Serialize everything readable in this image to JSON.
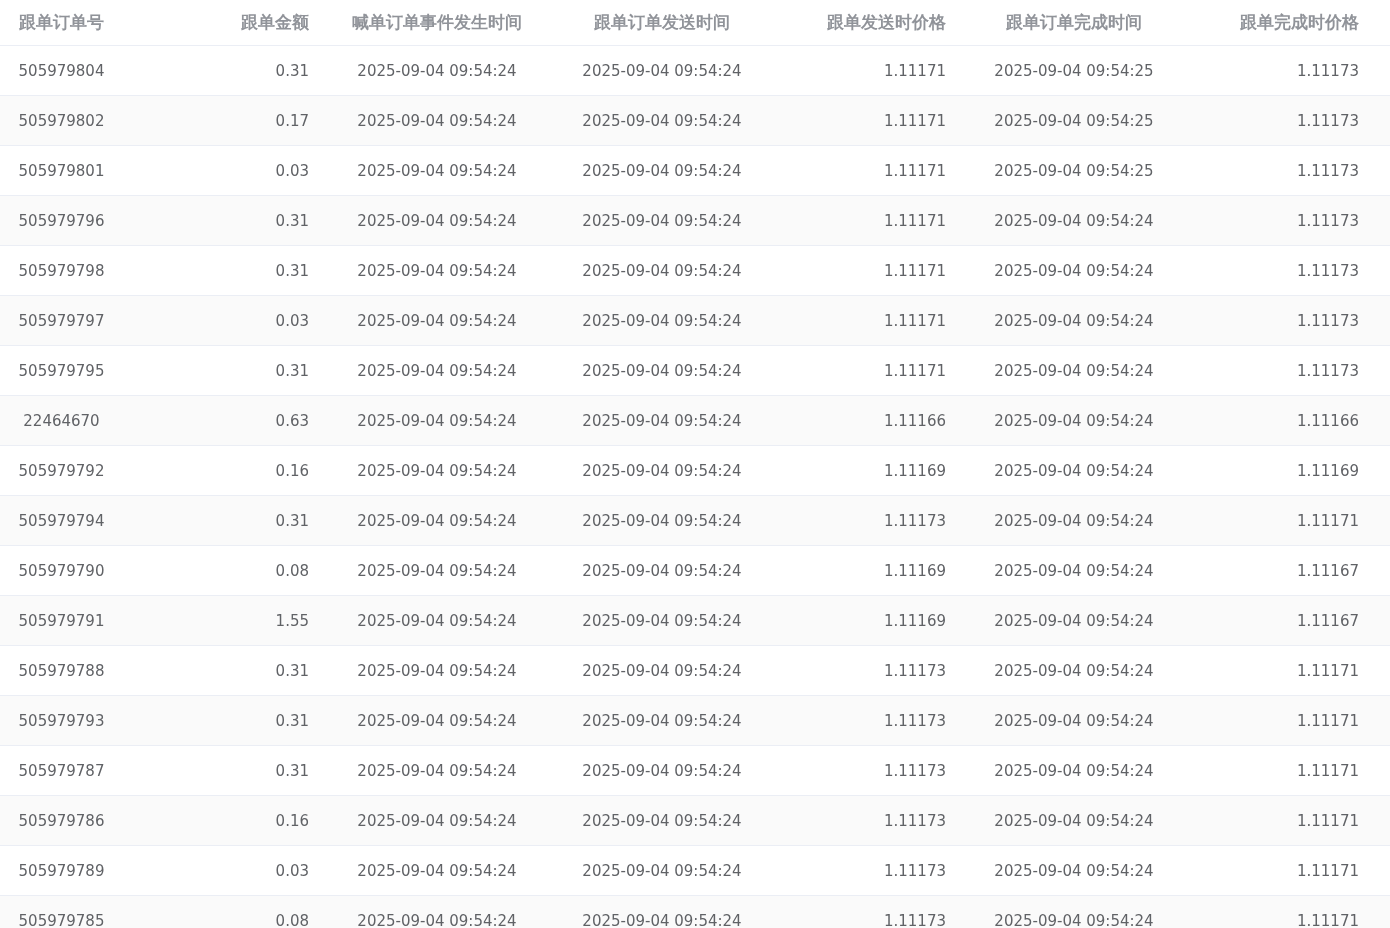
{
  "table": {
    "columns": [
      "跟单订单号",
      "跟单金额",
      "喊单订单事件发生时间",
      "跟单订单发送时间",
      "跟单发送时价格",
      "跟单订单完成时间",
      "跟单完成时价格"
    ],
    "rows": [
      [
        "505979804",
        "0.31",
        "2025-09-04 09:54:24",
        "2025-09-04 09:54:24",
        "1.11171",
        "2025-09-04 09:54:25",
        "1.11173"
      ],
      [
        "505979802",
        "0.17",
        "2025-09-04 09:54:24",
        "2025-09-04 09:54:24",
        "1.11171",
        "2025-09-04 09:54:25",
        "1.11173"
      ],
      [
        "505979801",
        "0.03",
        "2025-09-04 09:54:24",
        "2025-09-04 09:54:24",
        "1.11171",
        "2025-09-04 09:54:25",
        "1.11173"
      ],
      [
        "505979796",
        "0.31",
        "2025-09-04 09:54:24",
        "2025-09-04 09:54:24",
        "1.11171",
        "2025-09-04 09:54:24",
        "1.11173"
      ],
      [
        "505979798",
        "0.31",
        "2025-09-04 09:54:24",
        "2025-09-04 09:54:24",
        "1.11171",
        "2025-09-04 09:54:24",
        "1.11173"
      ],
      [
        "505979797",
        "0.03",
        "2025-09-04 09:54:24",
        "2025-09-04 09:54:24",
        "1.11171",
        "2025-09-04 09:54:24",
        "1.11173"
      ],
      [
        "505979795",
        "0.31",
        "2025-09-04 09:54:24",
        "2025-09-04 09:54:24",
        "1.11171",
        "2025-09-04 09:54:24",
        "1.11173"
      ],
      [
        "22464670",
        "0.63",
        "2025-09-04 09:54:24",
        "2025-09-04 09:54:24",
        "1.11166",
        "2025-09-04 09:54:24",
        "1.11166"
      ],
      [
        "505979792",
        "0.16",
        "2025-09-04 09:54:24",
        "2025-09-04 09:54:24",
        "1.11169",
        "2025-09-04 09:54:24",
        "1.11169"
      ],
      [
        "505979794",
        "0.31",
        "2025-09-04 09:54:24",
        "2025-09-04 09:54:24",
        "1.11173",
        "2025-09-04 09:54:24",
        "1.11171"
      ],
      [
        "505979790",
        "0.08",
        "2025-09-04 09:54:24",
        "2025-09-04 09:54:24",
        "1.11169",
        "2025-09-04 09:54:24",
        "1.11167"
      ],
      [
        "505979791",
        "1.55",
        "2025-09-04 09:54:24",
        "2025-09-04 09:54:24",
        "1.11169",
        "2025-09-04 09:54:24",
        "1.11167"
      ],
      [
        "505979788",
        "0.31",
        "2025-09-04 09:54:24",
        "2025-09-04 09:54:24",
        "1.11173",
        "2025-09-04 09:54:24",
        "1.11171"
      ],
      [
        "505979793",
        "0.31",
        "2025-09-04 09:54:24",
        "2025-09-04 09:54:24",
        "1.11173",
        "2025-09-04 09:54:24",
        "1.11171"
      ],
      [
        "505979787",
        "0.31",
        "2025-09-04 09:54:24",
        "2025-09-04 09:54:24",
        "1.11173",
        "2025-09-04 09:54:24",
        "1.11171"
      ],
      [
        "505979786",
        "0.16",
        "2025-09-04 09:54:24",
        "2025-09-04 09:54:24",
        "1.11173",
        "2025-09-04 09:54:24",
        "1.11171"
      ],
      [
        "505979789",
        "0.03",
        "2025-09-04 09:54:24",
        "2025-09-04 09:54:24",
        "1.11173",
        "2025-09-04 09:54:24",
        "1.11171"
      ],
      [
        "505979785",
        "0.08",
        "2025-09-04 09:54:24",
        "2025-09-04 09:54:24",
        "1.11173",
        "2025-09-04 09:54:24",
        "1.11171"
      ]
    ]
  }
}
